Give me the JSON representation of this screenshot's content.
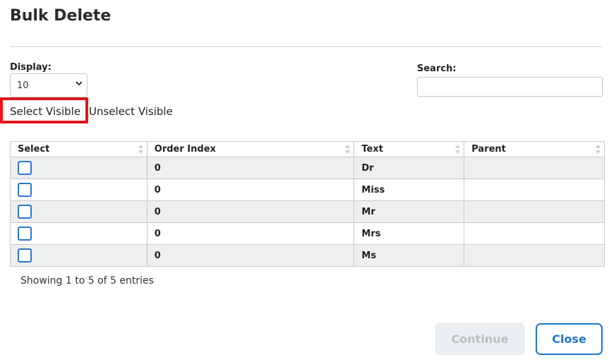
{
  "dialog": {
    "title": "Bulk Delete"
  },
  "controls": {
    "display_label": "Display:",
    "display_value": "10",
    "search_label": "Search:",
    "search_value": "",
    "select_visible": "Select Visible",
    "unselect_visible": "Unselect Visible"
  },
  "table": {
    "columns": [
      "Select",
      "Order Index",
      "Text",
      "Parent"
    ],
    "rows": [
      {
        "selected": false,
        "order_index": "0",
        "text": "Dr",
        "parent": ""
      },
      {
        "selected": false,
        "order_index": "0",
        "text": "Miss",
        "parent": ""
      },
      {
        "selected": false,
        "order_index": "0",
        "text": "Mr",
        "parent": ""
      },
      {
        "selected": false,
        "order_index": "0",
        "text": "Mrs",
        "parent": ""
      },
      {
        "selected": false,
        "order_index": "0",
        "text": "Ms",
        "parent": ""
      }
    ],
    "info": "Showing 1 to 5 of 5 entries"
  },
  "buttons": {
    "continue": "Continue",
    "close": "Close"
  },
  "colors": {
    "accent": "#1e76c8",
    "highlight": "#e0161e",
    "row_alt": "#eeefef"
  }
}
